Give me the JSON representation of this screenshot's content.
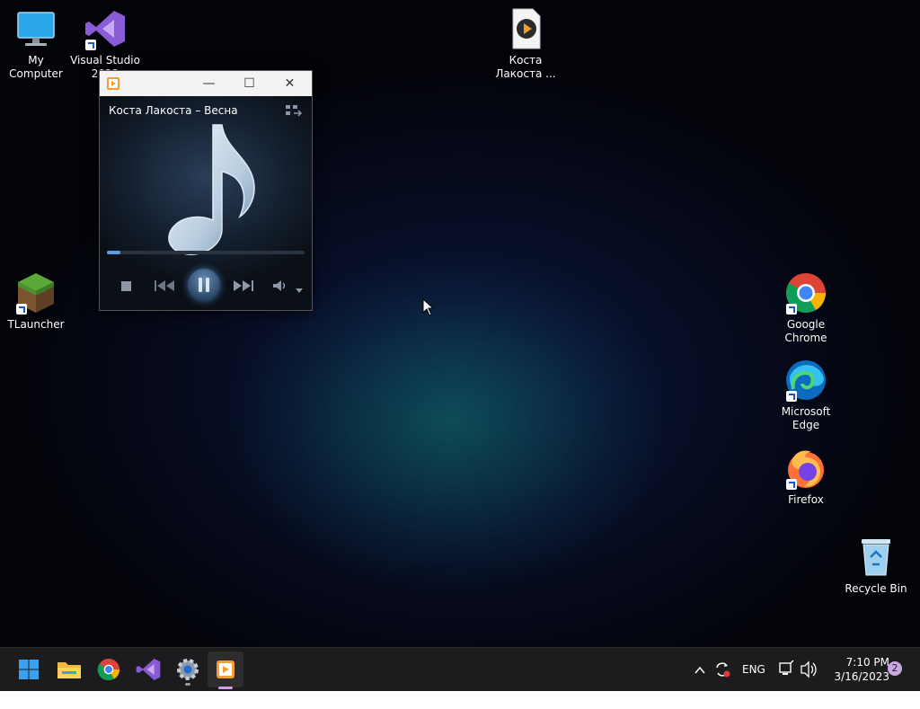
{
  "desktop": {
    "icons": [
      {
        "label": "My Computer"
      },
      {
        "label": "Visual Studio 2022"
      },
      {
        "label": "Коста Лакоста ..."
      },
      {
        "label": "TLauncher"
      },
      {
        "label": "Google Chrome"
      },
      {
        "label": "Microsoft Edge"
      },
      {
        "label": "Firefox"
      },
      {
        "label": "Recycle Bin"
      }
    ]
  },
  "player": {
    "track_title": "Коста Лакоста – Весна",
    "window_controls": {
      "minimize": "—",
      "maximize": "☐",
      "close": "✕"
    },
    "progress": 0.07,
    "state": "playing"
  },
  "taskbar": {
    "language": "ENG",
    "time": "7:10 PM",
    "date": "3/16/2023",
    "notification_count": "2"
  },
  "colors": {
    "taskbar_bg": "#1c1c1e",
    "accent_active": "#cfa0e8",
    "titlebar_bg": "#f3f3f3"
  }
}
